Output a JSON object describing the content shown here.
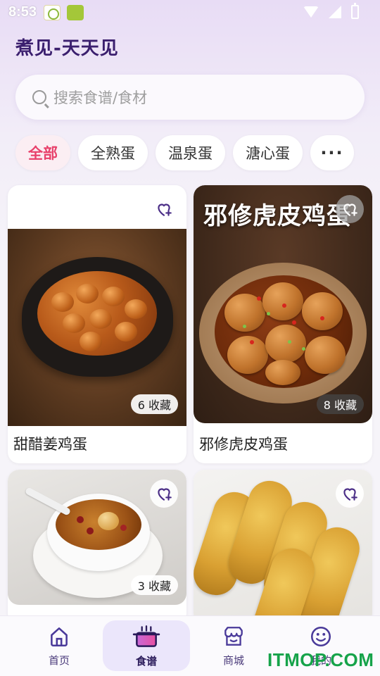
{
  "status_bar": {
    "time": "8:53"
  },
  "app_title": "煮见-天天见",
  "search": {
    "placeholder": "搜索食谱/食材"
  },
  "chips": [
    {
      "label": "全部",
      "active": true
    },
    {
      "label": "全熟蛋",
      "active": false
    },
    {
      "label": "温泉蛋",
      "active": false
    },
    {
      "label": "溏心蛋",
      "active": false
    },
    {
      "label": "···",
      "active": false
    }
  ],
  "recipes": [
    {
      "name": "甜醋姜鸡蛋",
      "favorites": "6 收藏"
    },
    {
      "name": "邪修虎皮鸡蛋",
      "favorites": "8 收藏",
      "photo_text": "邪修虎皮鸡蛋"
    },
    {
      "name": "",
      "favorites": "3 收藏"
    },
    {
      "name": "",
      "favorites": ""
    }
  ],
  "bottom_nav": [
    {
      "label": "首页",
      "icon": "home-icon",
      "active": false
    },
    {
      "label": "食谱",
      "icon": "pot-icon",
      "active": true
    },
    {
      "label": "商城",
      "icon": "shop-icon",
      "active": false
    },
    {
      "label": "我的",
      "icon": "smiley-icon",
      "active": false
    }
  ],
  "watermark": "ITMOP.COM",
  "colors": {
    "accent": "#e8416b",
    "title": "#3b1f6e",
    "nav_active_bg": "#ebe6fb"
  }
}
